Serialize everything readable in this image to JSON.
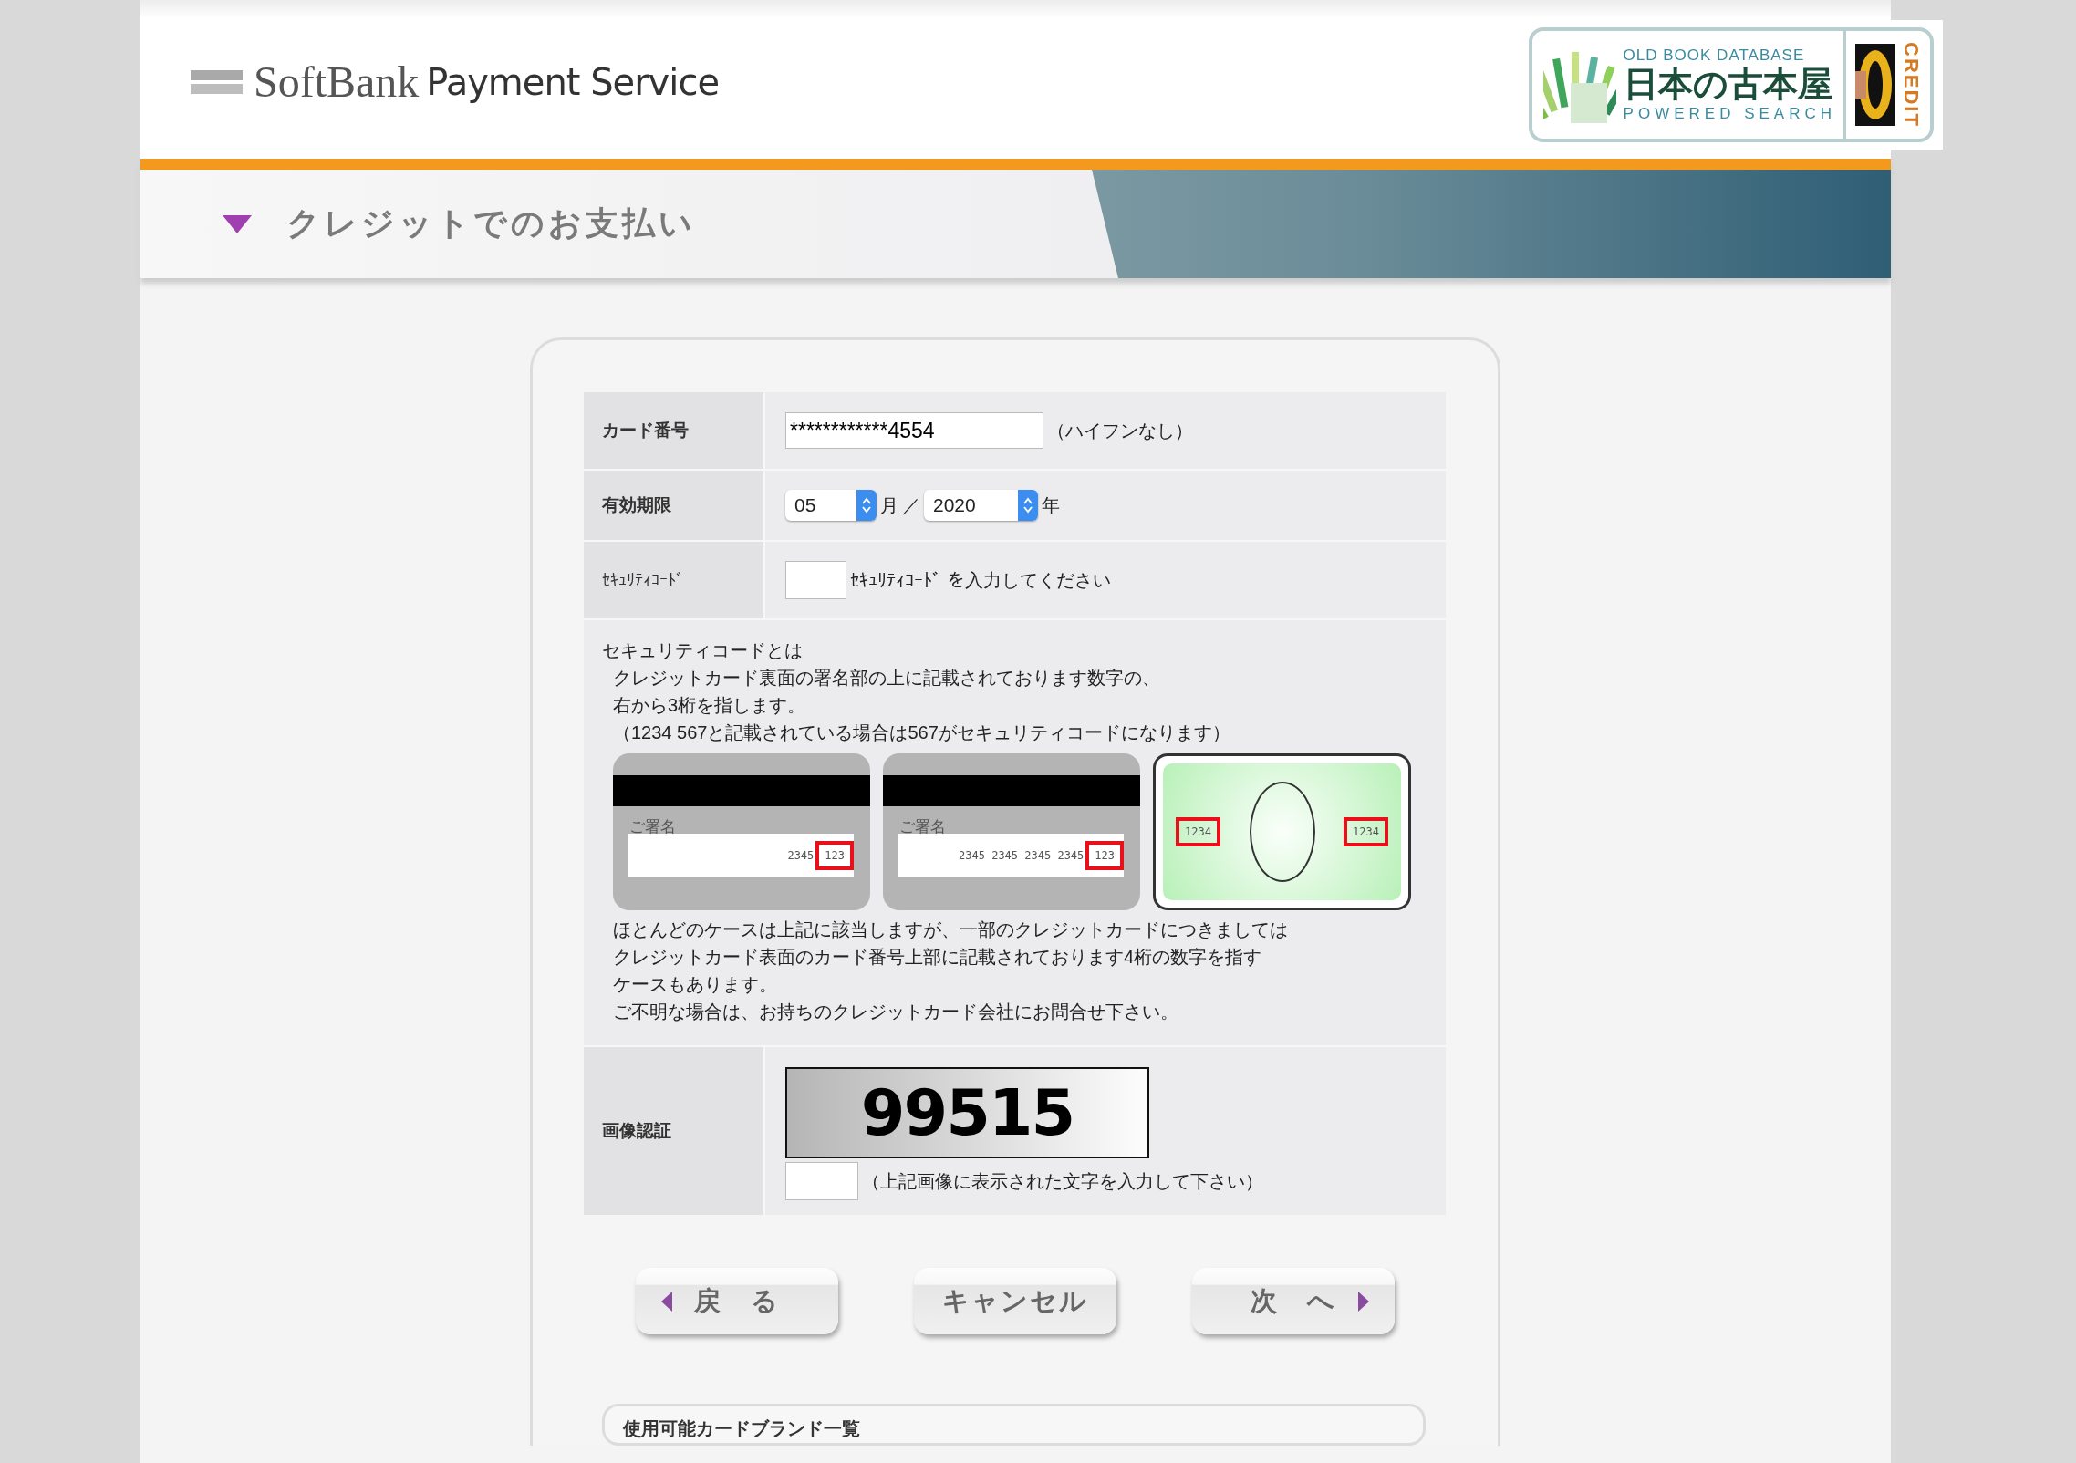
{
  "header": {
    "brand": "SoftBank",
    "service": "Payment Service",
    "partner_logo": {
      "top": "OLD BOOK DATABASE",
      "name": "日本の古本屋",
      "bottom": "POWERED SEARCH",
      "side": "CREDIT"
    }
  },
  "title": "クレジットでのお支払い",
  "form": {
    "card_number": {
      "label": "カード番号",
      "value": "************4554",
      "note": "（ハイフンなし）"
    },
    "expiry": {
      "label": "有効期限",
      "month": "05",
      "month_unit": "月",
      "separator": "／",
      "year": "2020",
      "year_unit": "年"
    },
    "security_code": {
      "label": "ｾｷｭﾘﾃｨｺｰﾄﾞ",
      "hint": "ｾｷｭﾘﾃｨｺｰﾄﾞ を入力してください"
    },
    "about": {
      "heading": "セキュリティコードとは",
      "lines": [
        "クレジットカード裏面の署名部の上に記載されております数字の、",
        "右から3桁を指します。",
        "（1234 567と記載されている場合は567がセキュリティコードになります）"
      ],
      "cards": [
        {
          "kind": "back",
          "signature": "ご署名",
          "numbers": "2345",
          "code": "123"
        },
        {
          "kind": "back",
          "signature": "ご署名",
          "numbers": "2345 2345 2345 2345",
          "code": "123"
        },
        {
          "kind": "front",
          "codes": [
            "1234",
            "1234"
          ]
        }
      ],
      "notes": [
        "ほとんどのケースは上記に該当しますが、一部のクレジットカードにつきましては",
        "クレジットカード表面のカード番号上部に記載されております4桁の数字を指す",
        "ケースもあります。",
        "ご不明な場合は、お持ちのクレジットカード会社にお問合せ下さい。"
      ]
    },
    "captcha": {
      "label": "画像認証",
      "image_text": "99515",
      "hint": "（上記画像に表示された文字を入力して下さい）"
    }
  },
  "buttons": [
    {
      "kind": "back",
      "label": "戻　る"
    },
    {
      "kind": "plain",
      "label": "キャンセル"
    },
    {
      "kind": "next",
      "label": "次　へ"
    }
  ],
  "brands": {
    "title": "使用可能カードブランド一覧"
  }
}
